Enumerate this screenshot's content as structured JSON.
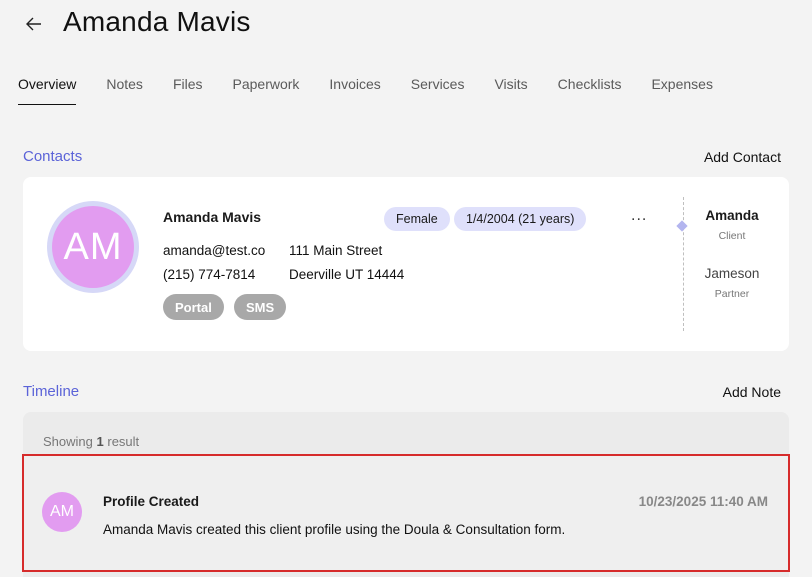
{
  "header": {
    "title": "Amanda Mavis",
    "back_icon": "arrow-left-icon"
  },
  "tabs": [
    {
      "label": "Overview",
      "active": true
    },
    {
      "label": "Notes"
    },
    {
      "label": "Files"
    },
    {
      "label": "Paperwork"
    },
    {
      "label": "Invoices"
    },
    {
      "label": "Services"
    },
    {
      "label": "Visits"
    },
    {
      "label": "Checklists"
    },
    {
      "label": "Expenses"
    }
  ],
  "contacts": {
    "title": "Contacts",
    "action": "Add Contact",
    "card": {
      "avatar_initials": "AM",
      "name": "Amanda Mavis",
      "gender": "Female",
      "dob": "1/4/2004 (21 years)",
      "email": "amanda@test.co",
      "phone": "(215) 774-7814",
      "address_line1": "111 Main Street",
      "address_line2": "Deerville UT 14444",
      "tags": [
        "Portal",
        "SMS"
      ],
      "more": "...",
      "related": [
        {
          "name": "Amanda",
          "role": "Client"
        },
        {
          "name": "Jameson",
          "role": "Partner"
        }
      ]
    }
  },
  "timeline": {
    "title": "Timeline",
    "action": "Add Note",
    "showing_prefix": "Showing",
    "showing_count": "1",
    "showing_suffix": "result",
    "items": [
      {
        "avatar_initials": "AM",
        "title": "Profile Created",
        "date": "10/23/2025 11:40 AM",
        "description": "Amanda Mavis created this client profile using the Doula & Consultation form."
      }
    ]
  },
  "colors": {
    "accent": "#5b63d8",
    "avatar": "#e29cf0",
    "highlight_border": "#d62b2b"
  }
}
